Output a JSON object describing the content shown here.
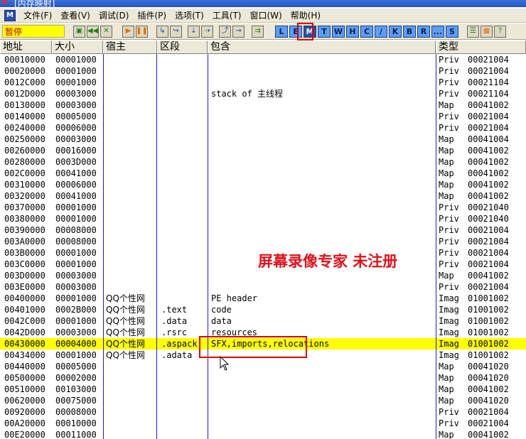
{
  "window": {
    "title": "[内存映射]"
  },
  "menu": {
    "items": [
      "文件(F)",
      "查看(V)",
      "调试(D)",
      "插件(P)",
      "选项(T)",
      "工具(T)",
      "窗口(W)",
      "帮助(H)"
    ]
  },
  "toolbar": {
    "status": "暂停",
    "window_buttons": [
      "L",
      "E",
      "M",
      "T",
      "W",
      "H",
      "C",
      "/",
      "K",
      "B",
      "R",
      "...",
      "S"
    ]
  },
  "table": {
    "columns": [
      "地址",
      "大小",
      "宿主",
      "区段",
      "包含",
      "类型"
    ],
    "rows": [
      [
        "00010000",
        "00001000",
        "",
        "",
        "",
        "Priv",
        "00021004"
      ],
      [
        "00020000",
        "00001000",
        "",
        "",
        "",
        "Priv",
        "00021004"
      ],
      [
        "0012C000",
        "00001000",
        "",
        "",
        "",
        "Priv",
        "00021104"
      ],
      [
        "0012D000",
        "00003000",
        "",
        "",
        "stack of 主线程",
        "Priv",
        "00021104"
      ],
      [
        "00130000",
        "00003000",
        "",
        "",
        "",
        "Map",
        "00041002"
      ],
      [
        "00140000",
        "00005000",
        "",
        "",
        "",
        "Priv",
        "00021004"
      ],
      [
        "00240000",
        "00006000",
        "",
        "",
        "",
        "Priv",
        "00021004"
      ],
      [
        "00250000",
        "00003000",
        "",
        "",
        "",
        "Map",
        "00041004"
      ],
      [
        "00260000",
        "00016000",
        "",
        "",
        "",
        "Map",
        "00041002"
      ],
      [
        "00280000",
        "0003D000",
        "",
        "",
        "",
        "Map",
        "00041002"
      ],
      [
        "002C0000",
        "00041000",
        "",
        "",
        "",
        "Map",
        "00041002"
      ],
      [
        "00310000",
        "00006000",
        "",
        "",
        "",
        "Map",
        "00041002"
      ],
      [
        "00320000",
        "00041000",
        "",
        "",
        "",
        "Map",
        "00041002"
      ],
      [
        "00370000",
        "00001000",
        "",
        "",
        "",
        "Priv",
        "00021040"
      ],
      [
        "00380000",
        "00001000",
        "",
        "",
        "",
        "Priv",
        "00021040"
      ],
      [
        "00390000",
        "00008000",
        "",
        "",
        "",
        "Priv",
        "00021004"
      ],
      [
        "003A0000",
        "00008000",
        "",
        "",
        "",
        "Priv",
        "00021004"
      ],
      [
        "003B0000",
        "00001000",
        "",
        "",
        "",
        "Priv",
        "00021004"
      ],
      [
        "003C0000",
        "00001000",
        "",
        "",
        "",
        "Priv",
        "00021004"
      ],
      [
        "003D0000",
        "00003000",
        "",
        "",
        "",
        "Map",
        "00041002"
      ],
      [
        "003E0000",
        "00003000",
        "",
        "",
        "",
        "Priv",
        "00021004"
      ],
      [
        "00400000",
        "00001000",
        "QQ个性网",
        "",
        "PE header",
        "Imag",
        "01001002"
      ],
      [
        "00401000",
        "0002B000",
        "QQ个性网",
        ".text",
        "code",
        "Imag",
        "01001002"
      ],
      [
        "0042C000",
        "00001000",
        "QQ个性网",
        ".data",
        "data",
        "Imag",
        "01001002"
      ],
      [
        "0042D000",
        "00003000",
        "QQ个性网",
        ".rsrc",
        "resources",
        "Imag",
        "01001002"
      ],
      [
        "00430000",
        "00004000",
        "QQ个性网",
        ".aspack",
        "SFX,imports,relocations",
        "Imag",
        "01001002"
      ],
      [
        "00434000",
        "00001000",
        "QQ个性网",
        ".adata",
        "",
        "Imag",
        "01001002"
      ],
      [
        "00440000",
        "00005000",
        "",
        "",
        "",
        "Map",
        "00041020"
      ],
      [
        "00500000",
        "00002000",
        "",
        "",
        "",
        "Map",
        "00041020"
      ],
      [
        "00510000",
        "00103000",
        "",
        "",
        "",
        "Map",
        "00041002"
      ],
      [
        "00620000",
        "00075000",
        "",
        "",
        "",
        "Map",
        "00041020"
      ],
      [
        "00920000",
        "00008000",
        "",
        "",
        "",
        "Priv",
        "00021004"
      ],
      [
        "00A20000",
        "00010000",
        "",
        "",
        "",
        "Priv",
        "00021004"
      ],
      [
        "00E20000",
        "00011000",
        "",
        "",
        "",
        "Map",
        "00041002"
      ]
    ],
    "selected_row": 25
  },
  "watermark": "屏幕录像专家  未注册",
  "colors": {
    "highlight": "#ffff00",
    "grid_line": "#1e1ecc",
    "annotation": "#e00000",
    "watermark": "#e0101a"
  }
}
